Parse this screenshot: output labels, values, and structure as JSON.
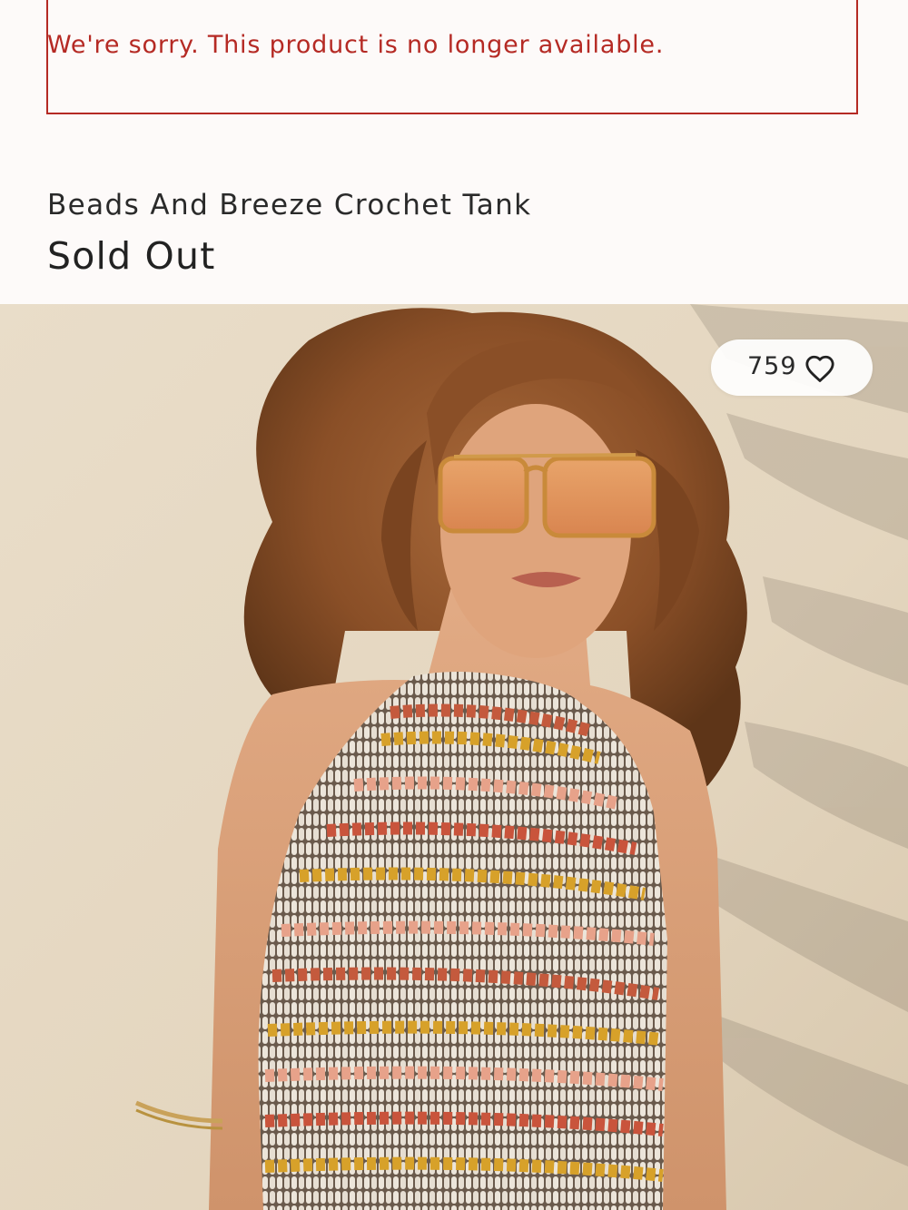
{
  "alert": {
    "message": "We're sorry. This product is no longer available."
  },
  "product": {
    "title": "Beads And Breeze Crochet Tank",
    "status": "Sold Out"
  },
  "image": {
    "like_count": "759",
    "heart_icon": "heart-outline-icon"
  },
  "colors": {
    "alert_red": "#b52a24",
    "page_bg": "#fdfaf9",
    "text": "#222222"
  }
}
